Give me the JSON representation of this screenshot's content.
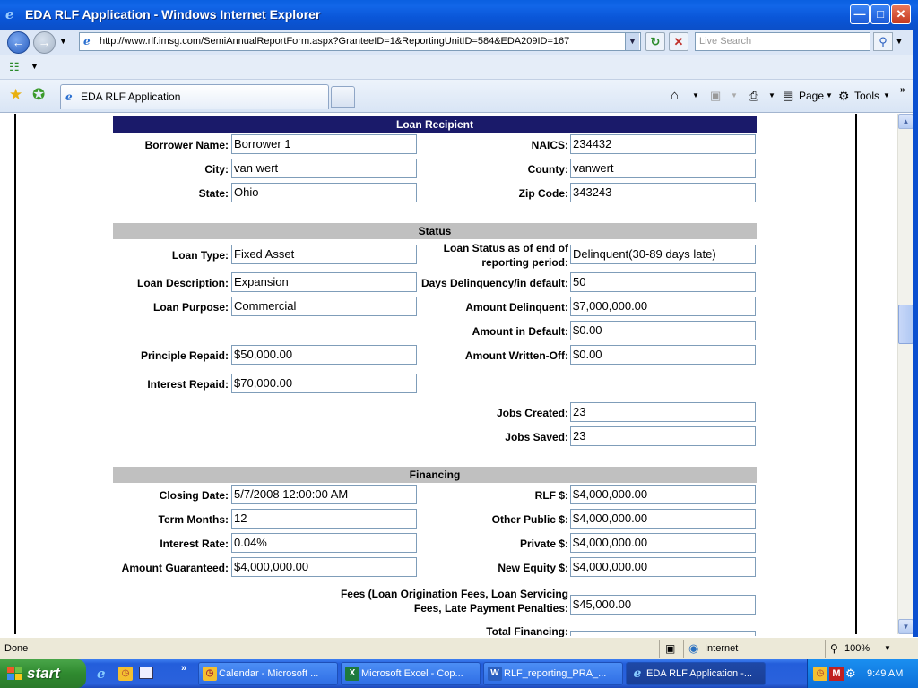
{
  "window": {
    "title": "EDA RLF Application - Windows Internet Explorer"
  },
  "toolbar": {
    "address": "http://www.rlf.imsg.com/SemiAnnualReportForm.aspx?GranteeID=1&ReportingUnitID=584&EDA209ID=167",
    "search_placeholder": "Live Search"
  },
  "tabs": {
    "active_label": "EDA RLF Application"
  },
  "commands": {
    "page": "Page",
    "tools": "Tools"
  },
  "sections": {
    "loan_recipient": "Loan Recipient",
    "status": "Status",
    "financing": "Financing"
  },
  "loan_recipient": {
    "borrower_name_label": "Borrower Name:",
    "borrower_name": "Borrower 1",
    "naics_label": "NAICS:",
    "naics": "234432",
    "city_label": "City:",
    "city": "van wert",
    "county_label": "County:",
    "county": "vanwert",
    "state_label": "State:",
    "state": "Ohio",
    "zip_label": "Zip Code:",
    "zip": "343243"
  },
  "status": {
    "loan_type_label": "Loan Type:",
    "loan_type": "Fixed Asset",
    "loan_status_label_1": "Loan Status as of end of",
    "loan_status_label_2": "reporting period:",
    "loan_status": "Delinquent(30-89 days late)",
    "loan_description_label": "Loan Description:",
    "loan_description": "Expansion",
    "days_delinquency_label": "Days Delinquency/in default:",
    "days_delinquency": "50",
    "loan_purpose_label": "Loan Purpose:",
    "loan_purpose": "Commercial",
    "amount_delinquent_label": "Amount Delinquent:",
    "amount_delinquent": "$7,000,000.00",
    "amount_in_default_label": "Amount in Default:",
    "amount_in_default": "$0.00",
    "principle_repaid_label": "Principle Repaid:",
    "principle_repaid": "$50,000.00",
    "amount_written_off_label": "Amount Written-Off:",
    "amount_written_off": "$0.00",
    "interest_repaid_label": "Interest Repaid:",
    "interest_repaid": "$70,000.00",
    "jobs_created_label": "Jobs Created:",
    "jobs_created": "23",
    "jobs_saved_label": "Jobs Saved:",
    "jobs_saved": "23"
  },
  "financing": {
    "closing_date_label": "Closing Date:",
    "closing_date": "5/7/2008 12:00:00 AM",
    "rlf_label": "RLF $:",
    "rlf": "$4,000,000.00",
    "term_months_label": "Term Months:",
    "term_months": "12",
    "other_public_label": "Other Public $:",
    "other_public": "$4,000,000.00",
    "interest_rate_label": "Interest Rate:",
    "interest_rate": "0.04%",
    "private_label": "Private $:",
    "private": "$4,000,000.00",
    "amount_guaranteed_label": "Amount Guaranteed:",
    "amount_guaranteed": "$4,000,000.00",
    "new_equity_label": "New Equity $:",
    "new_equity": "$4,000,000.00",
    "fees_label_1": "Fees (Loan Origination Fees, Loan Servicing",
    "fees_label_2": "Fees, Late Payment Penalties:",
    "fees": "$45,000.00",
    "total_financing_label": "Total Financing:"
  },
  "statusbar": {
    "status": "Done",
    "zone": "Internet",
    "zoom": "100%"
  },
  "taskbar": {
    "start": "start",
    "items": [
      "Calendar - Microsoft ...",
      "Microsoft Excel - Cop...",
      "RLF_reporting_PRA_...",
      "EDA RLF Application -..."
    ],
    "clock": "9:49 AM"
  }
}
